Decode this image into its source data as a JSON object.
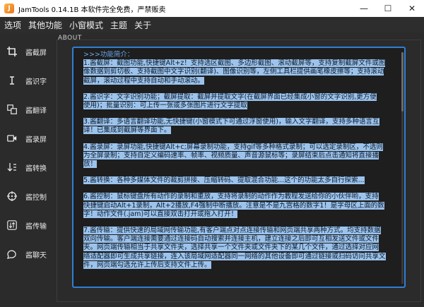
{
  "window": {
    "title": "JamTools 0.14.1B  本软件完全免费，严禁贩卖",
    "controls": [
      "—",
      "☐",
      "✕"
    ]
  },
  "menu": [
    "选项",
    "其他功能",
    "小窗模式",
    "主题",
    "关于"
  ],
  "sidebar": {
    "items": [
      {
        "label": "酱截屏",
        "icon": "crop-icon"
      },
      {
        "label": "酱识字",
        "icon": "text-cursor-icon"
      },
      {
        "label": "酱翻译",
        "icon": "translate-icon"
      },
      {
        "label": "酱录屏",
        "icon": "video-camera-icon"
      },
      {
        "label": "酱转换",
        "icon": "convert-icon"
      },
      {
        "label": "酱控制",
        "icon": "target-icon"
      },
      {
        "label": "酱传输",
        "icon": "transfer-icon"
      },
      {
        "label": "酱聊天",
        "icon": "chat-icon"
      }
    ]
  },
  "about": {
    "label": "ABOUT",
    "heading": ">>>功能简介：",
    "paragraphs": [
      [
        "1.酱截屏：截图功能,快捷键Alt+z！支持选区截图、多边形截图、滚动截屏等，支持复制截屏文件或图",
        "像数据到剪切板、支持截图中文字识别(翻译)、图像识别等，左侧工具栏提供画笔橡皮擦等；支持滚动",
        "截屏，滚动过程中支持自动和手动滚动。"
      ],
      [
        "2.酱识字：文字识别功能；截屏提取：截屏并提取文字(在截屏界面已经集成小窗的文字识别,更方便",
        "使用)；批量识别：可上传一张或多张图片进行文字提取"
      ],
      [
        "3.酱翻译：多语言翻译功能,无快捷键(小窗模式下可通过浮窗使用)，输入文字翻译，支持多种语言互",
        "译！已集成到截屏等界面下。"
      ],
      [
        "4.酱录屏：录屏功能,快捷键Alt+c;屏幕录制功能，支持gif等多种格式录制；可以选定录制区，不选则",
        "为全屏录制；支持自定义编码速率、帧率、视频质量、声音源鼠标等；录屏结束后点击通知将直接播",
        "放！"
      ],
      [
        "5.酱转换：各种多媒体文件的裁剪拼接、压缩转码、提取混合功能...这个的功能太多自行探索..."
      ],
      [
        "6.酱控制：鼠标键盘所有动作的录制和重放，支持将录制的动作作为教程发送给你的小伙伴哟，支持",
        "快捷键启动Alt+1录制，Alt+2播放,F4强制中断播放。注意是不是九宫格的数字1！是字母区上面的数",
        "字！动作文件(.jam)可以直接双击打开或拖入打开！"
      ],
      [
        "7.酱传输：提供快速的局域网传输功能,有客户端点对点连接传输和网页端共享两种方式。均支持数据",
        "双向传输。客户端连接需要通过连接码自动搜索并连接主机，建立连接之后即可互相发送文件或文件",
        "夹。网页端传输相当于共享文件夹，选择共享一个文件夹或文件夹下的某几个文件，通过选择对应网",
        "络适配器即可生成共享链接，连入该局域网适配器同一网络的其他设备即可通过链接或扫码访问共享文",
        "件，网页端勾选允许上传后支持文件上传。"
      ]
    ]
  }
}
